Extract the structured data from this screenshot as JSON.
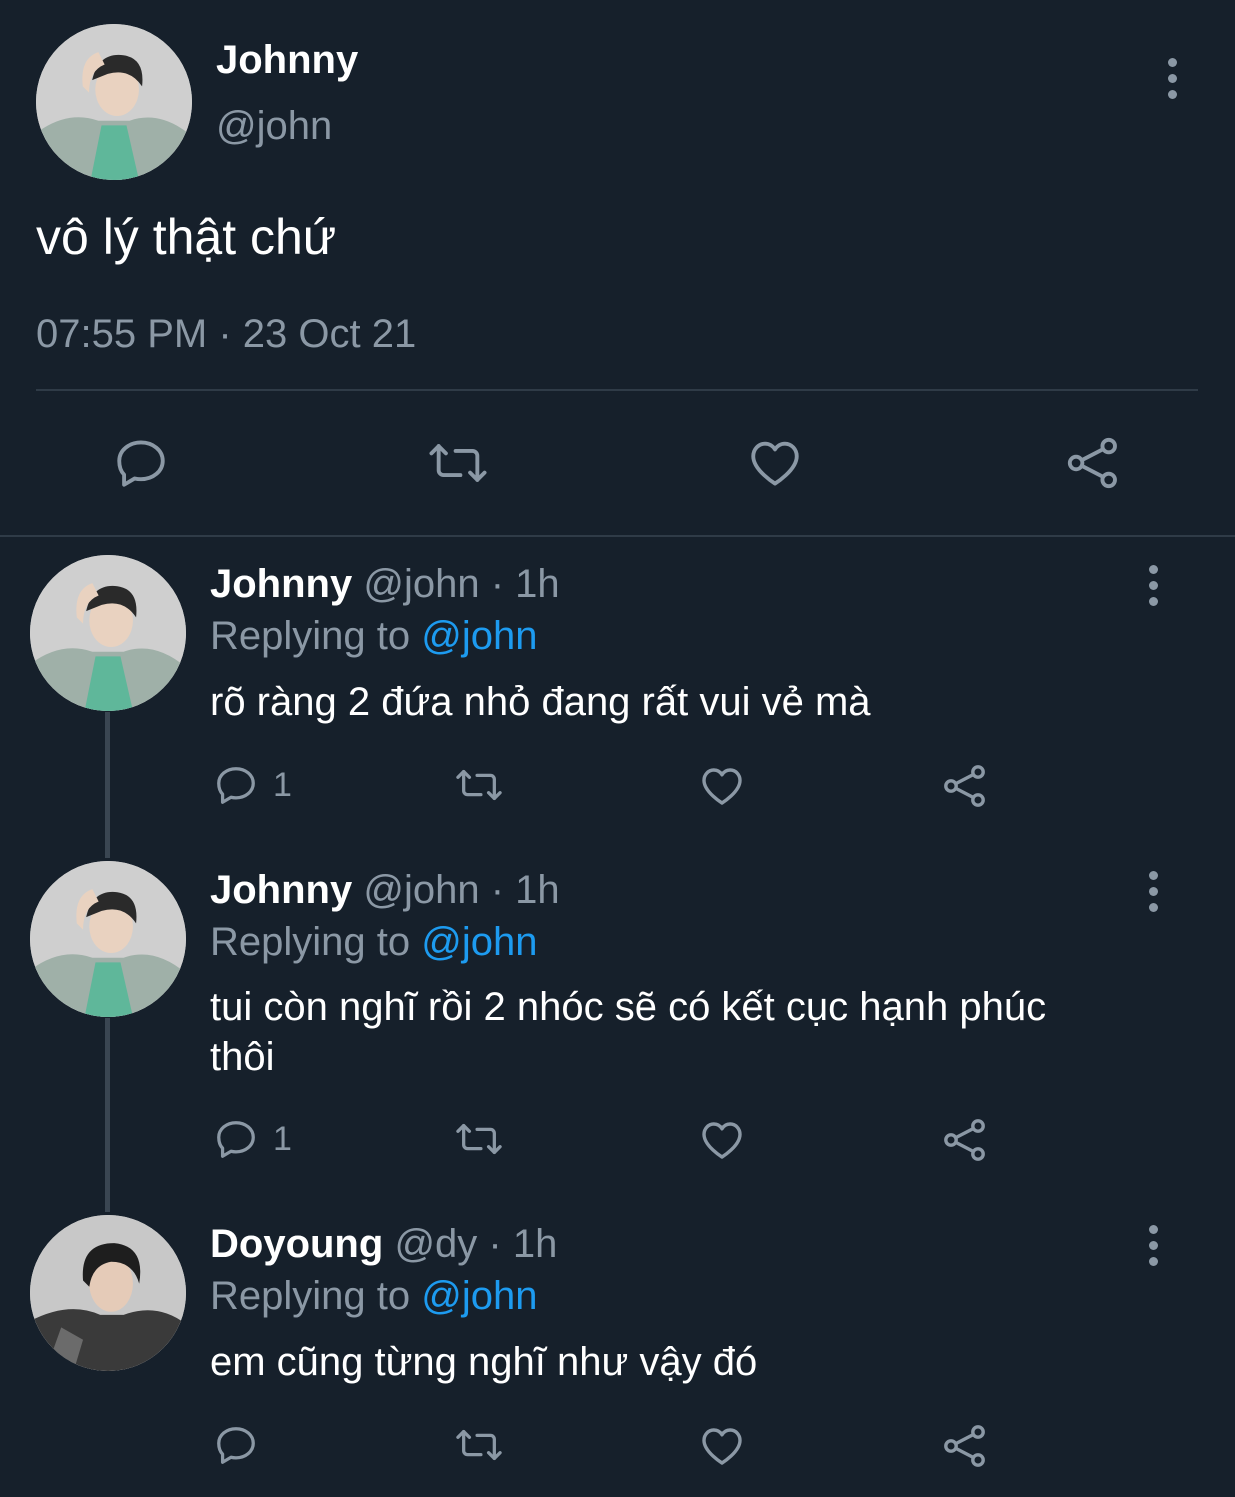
{
  "main_tweet": {
    "name": "Johnny",
    "handle": "@john",
    "text": "vô lý thật chứ",
    "timestamp": "07:55 PM · 23 Oct 21"
  },
  "replies": [
    {
      "name": "Johnny",
      "handle": "@john",
      "time": "· 1h",
      "replying_label": "Replying to",
      "replying_to": "@john",
      "text": "rõ ràng 2 đứa nhỏ đang rất vui vẻ mà",
      "reply_count": "1"
    },
    {
      "name": "Johnny",
      "handle": "@john",
      "time": "· 1h",
      "replying_label": "Replying to",
      "replying_to": "@john",
      "text": "tui còn nghĩ rồi 2 nhóc sẽ có kết cục hạnh phúc thôi",
      "reply_count": "1"
    },
    {
      "name": "Doyoung",
      "handle": "@dy",
      "time": "· 1h",
      "replying_label": "Replying to",
      "replying_to": "@john",
      "text": "em cũng từng nghĩ như vậy đó",
      "reply_count": ""
    }
  ],
  "icons": [
    "reply-icon",
    "retweet-icon",
    "like-icon",
    "share-icon",
    "more-options-icon"
  ],
  "colors": {
    "background": "#16202b",
    "muted": "#8b98a5",
    "link": "#1d9bf0"
  }
}
